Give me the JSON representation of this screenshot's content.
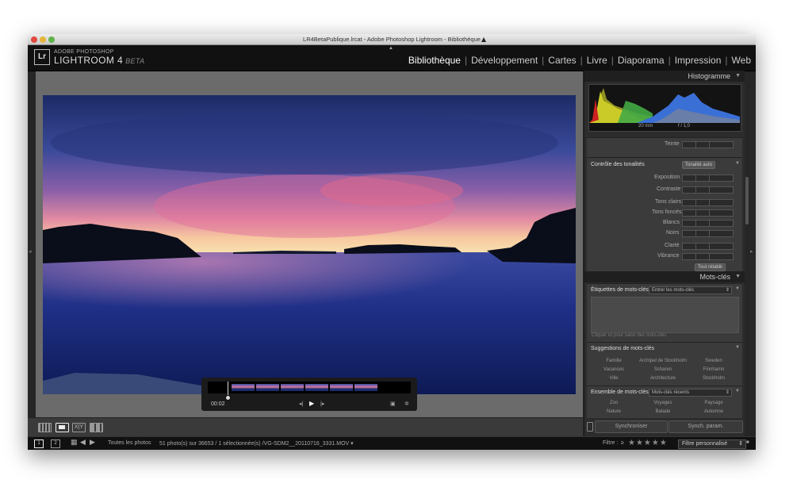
{
  "window": {
    "title": "LR4BetaPublique.lrcat - Adobe Photoshop Lightroom - Bibliothèque"
  },
  "brand": {
    "top": "ADOBE PHOTOSHOP",
    "product": "LIGHTROOM 4",
    "tag": "BETA",
    "badge": "Lr"
  },
  "modules": [
    "Bibliothèque",
    "Développement",
    "Cartes",
    "Livre",
    "Diaporama",
    "Impression",
    "Web"
  ],
  "player": {
    "timecode": "00:02"
  },
  "toolbar": {
    "compare_label": "X|Y"
  },
  "panel": {
    "histogram_title": "Histogramme",
    "histogram_info": {
      "focal": "20 mm",
      "aperture": "f / 1,0"
    },
    "teinte": "Teinte",
    "tonal_control": "Contrôle des tonalités",
    "auto_tone": "Tonalité auto",
    "exposition": "Exposition",
    "contraste": "Contraste",
    "tons_clairs": "Tons clairs",
    "tons_fonces": "Tons foncés",
    "blancs": "Blancs",
    "noirs": "Noirs",
    "clarte": "Clarté",
    "vibrance": "Vibrance",
    "reset_all": "Tout rétablir",
    "keywords_title": "Mots-clés",
    "keyword_tags_label": "Étiquettes de mots-clés",
    "keyword_tags_select": "Entrer les mots-clés",
    "keyword_hint": "Cliquer ici pour saisir des mots-clés",
    "suggestions_label": "Suggestions de mots-clés",
    "suggestions": [
      "Famille",
      "Archipel de Stockholm",
      "Sweden",
      "Vacances",
      "Scharen",
      "Finnhamn",
      "Ville",
      "Architecture",
      "Stockholm"
    ],
    "keyword_set_label": "Ensemble de mots-clés",
    "keyword_set_select": "Mots-clés récents",
    "keyword_set": [
      "Zoo",
      "Voyages",
      "Paysage",
      "Nature",
      "Balade",
      "Automne"
    ],
    "sync_label": "Synchroniser",
    "sync_settings_label": "Synch. param."
  },
  "status": {
    "screen1": "1",
    "screen2": "2",
    "source": "Toutes les photos",
    "info": "51 photo(s) sur 36653 / 1 sélectionnée(s) /VG-SDM2__20110716_3331.MOV ▾",
    "filter_label": "Filtre :",
    "filter_op": "≥",
    "stars": "★★★★★",
    "filter_select": "Filtre personnalisé"
  }
}
